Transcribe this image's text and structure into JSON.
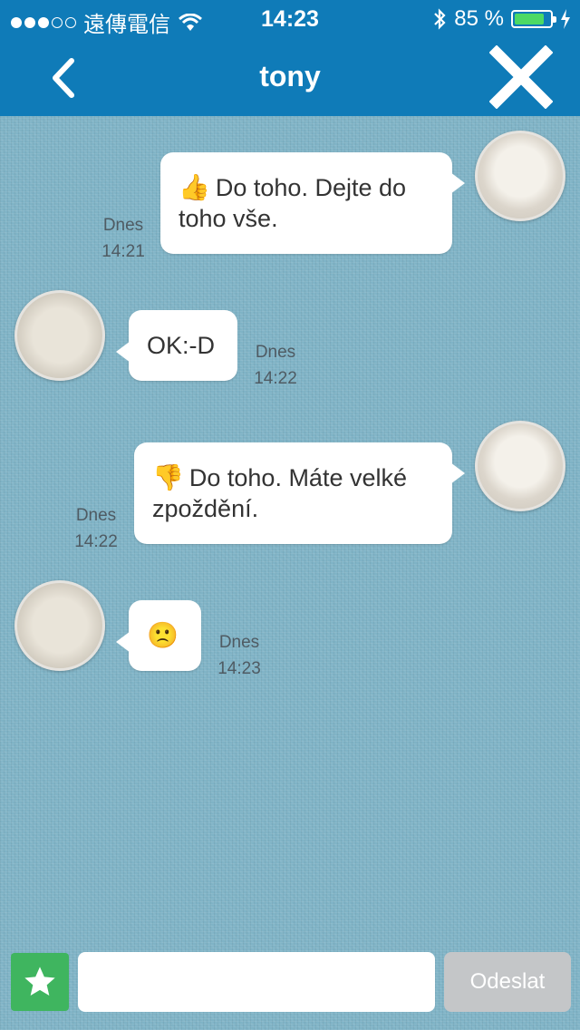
{
  "status_bar": {
    "carrier": "遠傳電信",
    "time": "14:23",
    "battery_text": "85 %",
    "battery_level": 0.85
  },
  "header": {
    "title": "tony",
    "back_icon": "chevron-left-icon",
    "close_icon": "close-icon"
  },
  "messages": [
    {
      "side": "right",
      "emoji": "👍",
      "text": "Do toho. Dejte do toho vše.",
      "day": "Dnes",
      "time": "14:21"
    },
    {
      "side": "left",
      "emoji": "",
      "text": "OK:-D",
      "day": "Dnes",
      "time": "14:22"
    },
    {
      "side": "right",
      "emoji": "👎",
      "text": "Do toho. Máte velké zpoždění.",
      "day": "Dnes",
      "time": "14:22"
    },
    {
      "side": "left",
      "emoji": "🙁",
      "text": "",
      "day": "Dnes",
      "time": "14:23"
    }
  ],
  "input_bar": {
    "star_icon": "star-icon",
    "placeholder": "",
    "send_label": "Odeslat"
  },
  "colors": {
    "header_bg": "#0f7bb8",
    "chat_bg": "#7fb3c6",
    "star_button": "#3fb55f",
    "send_button_disabled": "#c4c6c8",
    "battery_fill": "#4cd964"
  }
}
